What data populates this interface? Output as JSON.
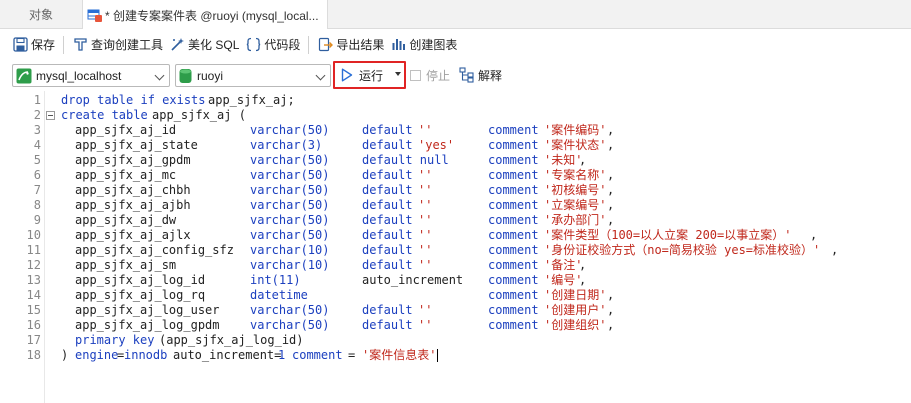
{
  "tabs": {
    "objects": "对象",
    "query": "* 创建专案案件表 @ruoyi (mysql_local..."
  },
  "toolbar": {
    "save": "保存",
    "query_builder": "查询创建工具",
    "beautify": "美化 SQL",
    "snippet": "代码段",
    "export": "导出结果",
    "chart": "创建图表"
  },
  "toolbar2": {
    "connection": "mysql_localhost",
    "database": "ruoyi",
    "run": "运行",
    "stop": "停止",
    "explain": "解释"
  },
  "colors": {
    "keyword": "#1b3fbf",
    "string": "#c0281c",
    "highlight": "#e02424"
  },
  "code": [
    {
      "n": "1",
      "fold": false,
      "segs": [
        {
          "c": 0,
          "k": "kw",
          "t": "drop table if exists"
        },
        {
          "c": 21,
          "k": "id",
          "t": "app_sjfx_aj;"
        }
      ]
    },
    {
      "n": "2",
      "fold": true,
      "segs": [
        {
          "c": 0,
          "k": "kw",
          "t": "create table"
        },
        {
          "c": 13,
          "k": "id",
          "t": "app_sjfx_aj ("
        }
      ]
    },
    {
      "n": "3",
      "fold": false,
      "segs": [
        {
          "c": 2,
          "k": "id",
          "t": "app_sjfx_aj_id"
        },
        {
          "c": 27,
          "k": "kw",
          "t": "varchar(50)"
        },
        {
          "c": 43,
          "k": "kw",
          "t": "default"
        },
        {
          "c": 51,
          "k": "str",
          "t": "''"
        },
        {
          "c": 61,
          "k": "kw",
          "t": "comment"
        },
        {
          "c": 69,
          "k": "str",
          "t": "'案件编码'"
        },
        {
          "c": 78,
          "k": "id",
          "t": ","
        }
      ]
    },
    {
      "n": "4",
      "fold": false,
      "segs": [
        {
          "c": 2,
          "k": "id",
          "t": "app_sjfx_aj_state"
        },
        {
          "c": 27,
          "k": "kw",
          "t": "varchar(3)"
        },
        {
          "c": 43,
          "k": "kw",
          "t": "default"
        },
        {
          "c": 51,
          "k": "str",
          "t": "'yes'"
        },
        {
          "c": 61,
          "k": "kw",
          "t": "comment"
        },
        {
          "c": 69,
          "k": "str",
          "t": "'案件状态'"
        },
        {
          "c": 78,
          "k": "id",
          "t": ","
        }
      ]
    },
    {
      "n": "5",
      "fold": false,
      "segs": [
        {
          "c": 2,
          "k": "id",
          "t": "app_sjfx_aj_gpdm"
        },
        {
          "c": 27,
          "k": "kw",
          "t": "varchar(50)"
        },
        {
          "c": 43,
          "k": "kw",
          "t": "default null"
        },
        {
          "c": 61,
          "k": "kw",
          "t": "comment"
        },
        {
          "c": 69,
          "k": "str",
          "t": "'未知'"
        },
        {
          "c": 74,
          "k": "id",
          "t": ","
        }
      ]
    },
    {
      "n": "6",
      "fold": false,
      "segs": [
        {
          "c": 2,
          "k": "id",
          "t": "app_sjfx_aj_mc"
        },
        {
          "c": 27,
          "k": "kw",
          "t": "varchar(50)"
        },
        {
          "c": 43,
          "k": "kw",
          "t": "default"
        },
        {
          "c": 51,
          "k": "str",
          "t": "''"
        },
        {
          "c": 61,
          "k": "kw",
          "t": "comment"
        },
        {
          "c": 69,
          "k": "str",
          "t": "'专案名称'"
        },
        {
          "c": 78,
          "k": "id",
          "t": ","
        }
      ]
    },
    {
      "n": "7",
      "fold": false,
      "segs": [
        {
          "c": 2,
          "k": "id",
          "t": "app_sjfx_aj_chbh"
        },
        {
          "c": 27,
          "k": "kw",
          "t": "varchar(50)"
        },
        {
          "c": 43,
          "k": "kw",
          "t": "default"
        },
        {
          "c": 51,
          "k": "str",
          "t": "''"
        },
        {
          "c": 61,
          "k": "kw",
          "t": "comment"
        },
        {
          "c": 69,
          "k": "str",
          "t": "'初核编号'"
        },
        {
          "c": 78,
          "k": "id",
          "t": ","
        }
      ]
    },
    {
      "n": "8",
      "fold": false,
      "segs": [
        {
          "c": 2,
          "k": "id",
          "t": "app_sjfx_aj_ajbh"
        },
        {
          "c": 27,
          "k": "kw",
          "t": "varchar(50)"
        },
        {
          "c": 43,
          "k": "kw",
          "t": "default"
        },
        {
          "c": 51,
          "k": "str",
          "t": "''"
        },
        {
          "c": 61,
          "k": "kw",
          "t": "comment"
        },
        {
          "c": 69,
          "k": "str",
          "t": "'立案编号'"
        },
        {
          "c": 78,
          "k": "id",
          "t": ","
        }
      ]
    },
    {
      "n": "9",
      "fold": false,
      "segs": [
        {
          "c": 2,
          "k": "id",
          "t": "app_sjfx_aj_dw"
        },
        {
          "c": 27,
          "k": "kw",
          "t": "varchar(50)"
        },
        {
          "c": 43,
          "k": "kw",
          "t": "default"
        },
        {
          "c": 51,
          "k": "str",
          "t": "''"
        },
        {
          "c": 61,
          "k": "kw",
          "t": "comment"
        },
        {
          "c": 69,
          "k": "str",
          "t": "'承办部门'"
        },
        {
          "c": 78,
          "k": "id",
          "t": ","
        }
      ]
    },
    {
      "n": "10",
      "fold": false,
      "segs": [
        {
          "c": 2,
          "k": "id",
          "t": "app_sjfx_aj_ajlx"
        },
        {
          "c": 27,
          "k": "kw",
          "t": "varchar(50)"
        },
        {
          "c": 43,
          "k": "kw",
          "t": "default"
        },
        {
          "c": 51,
          "k": "str",
          "t": "''"
        },
        {
          "c": 61,
          "k": "kw",
          "t": "comment"
        },
        {
          "c": 69,
          "k": "str",
          "t": "'案件类型（100=以人立案 200=以事立案）'"
        },
        {
          "c": 107,
          "k": "id",
          "t": ","
        }
      ]
    },
    {
      "n": "11",
      "fold": false,
      "segs": [
        {
          "c": 2,
          "k": "id",
          "t": "app_sjfx_aj_config_sfz"
        },
        {
          "c": 27,
          "k": "kw",
          "t": "varchar(10)"
        },
        {
          "c": 43,
          "k": "kw",
          "t": "default"
        },
        {
          "c": 51,
          "k": "str",
          "t": "''"
        },
        {
          "c": 61,
          "k": "kw",
          "t": "comment"
        },
        {
          "c": 69,
          "k": "str",
          "t": "'身份证校验方式（no=简易校验 yes=标准校验）'"
        },
        {
          "c": 110,
          "k": "id",
          "t": ","
        }
      ]
    },
    {
      "n": "12",
      "fold": false,
      "segs": [
        {
          "c": 2,
          "k": "id",
          "t": "app_sjfx_aj_sm"
        },
        {
          "c": 27,
          "k": "kw",
          "t": "varchar(10)"
        },
        {
          "c": 43,
          "k": "kw",
          "t": "default"
        },
        {
          "c": 51,
          "k": "str",
          "t": "''"
        },
        {
          "c": 61,
          "k": "kw",
          "t": "comment"
        },
        {
          "c": 69,
          "k": "str",
          "t": "'备注'"
        },
        {
          "c": 74,
          "k": "id",
          "t": ","
        }
      ]
    },
    {
      "n": "13",
      "fold": false,
      "segs": [
        {
          "c": 2,
          "k": "id",
          "t": "app_sjfx_aj_log_id"
        },
        {
          "c": 27,
          "k": "kw",
          "t": "int(11)"
        },
        {
          "c": 43,
          "k": "id",
          "t": "auto_increment"
        },
        {
          "c": 61,
          "k": "kw",
          "t": "comment"
        },
        {
          "c": 69,
          "k": "str",
          "t": "'编号'"
        },
        {
          "c": 74,
          "k": "id",
          "t": ","
        }
      ]
    },
    {
      "n": "14",
      "fold": false,
      "segs": [
        {
          "c": 2,
          "k": "id",
          "t": "app_sjfx_aj_log_rq"
        },
        {
          "c": 27,
          "k": "kw",
          "t": "datetime"
        },
        {
          "c": 61,
          "k": "kw",
          "t": "comment"
        },
        {
          "c": 69,
          "k": "str",
          "t": "'创建日期'"
        },
        {
          "c": 78,
          "k": "id",
          "t": ","
        }
      ]
    },
    {
      "n": "15",
      "fold": false,
      "segs": [
        {
          "c": 2,
          "k": "id",
          "t": "app_sjfx_aj_log_user"
        },
        {
          "c": 27,
          "k": "kw",
          "t": "varchar(50)"
        },
        {
          "c": 43,
          "k": "kw",
          "t": "default"
        },
        {
          "c": 51,
          "k": "str",
          "t": "''"
        },
        {
          "c": 61,
          "k": "kw",
          "t": "comment"
        },
        {
          "c": 69,
          "k": "str",
          "t": "'创建用户'"
        },
        {
          "c": 78,
          "k": "id",
          "t": ","
        }
      ]
    },
    {
      "n": "16",
      "fold": false,
      "segs": [
        {
          "c": 2,
          "k": "id",
          "t": "app_sjfx_aj_log_gpdm"
        },
        {
          "c": 27,
          "k": "kw",
          "t": "varchar(50)"
        },
        {
          "c": 43,
          "k": "kw",
          "t": "default"
        },
        {
          "c": 51,
          "k": "str",
          "t": "''"
        },
        {
          "c": 61,
          "k": "kw",
          "t": "comment"
        },
        {
          "c": 69,
          "k": "str",
          "t": "'创建组织'"
        },
        {
          "c": 78,
          "k": "id",
          "t": ","
        }
      ]
    },
    {
      "n": "17",
      "fold": false,
      "segs": [
        {
          "c": 2,
          "k": "kw",
          "t": "primary key"
        },
        {
          "c": 14,
          "k": "id",
          "t": "(app_sjfx_aj_log_id)"
        }
      ]
    },
    {
      "n": "18",
      "fold": false,
      "segs": [
        {
          "c": 0,
          "k": "id",
          "t": ")"
        },
        {
          "c": 2,
          "k": "kw",
          "t": "engine"
        },
        {
          "c": 8,
          "k": "id",
          "t": "="
        },
        {
          "c": 9,
          "k": "kw",
          "t": "innodb"
        },
        {
          "c": 16,
          "k": "id",
          "t": "auto_increment="
        },
        {
          "c": 31,
          "k": "kw",
          "t": "1"
        },
        {
          "c": 33,
          "k": "kw",
          "t": "comment"
        },
        {
          "c": 41,
          "k": "id",
          "t": "="
        },
        {
          "c": 43,
          "k": "str",
          "t": "'案件信息表'"
        }
      ]
    }
  ]
}
